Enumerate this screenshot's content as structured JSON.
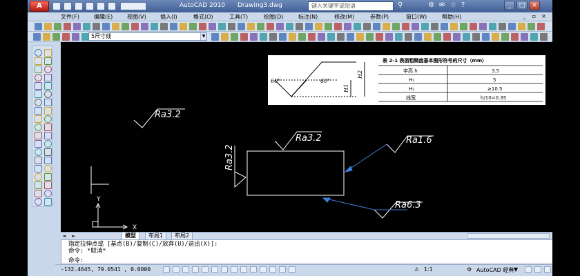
{
  "titlebar": {
    "logo": "A",
    "app_title": "AutoCAD 2010",
    "file_title": "Drawing3.dwg",
    "search_placeholder": "键入关键字或短语",
    "minimize": "_",
    "maximize": "□",
    "close": "×"
  },
  "menu": {
    "items": [
      "文件(F)",
      "编辑(E)",
      "视图(V)",
      "插入(I)",
      "格式(O)",
      "工具(T)",
      "绘图(D)",
      "标注(N)",
      "修改(M)",
      "参数(P)",
      "窗口(W)",
      "帮助(H)"
    ]
  },
  "layers": {
    "current_layer": "5尺寸线"
  },
  "drawing": {
    "roughness_labels": [
      "Ra3.2",
      "Ra3.2",
      "Ra1.6",
      "Ra3.2",
      "Ra6.3"
    ],
    "ucs_x": "X",
    "ucs_y": "Y"
  },
  "reference": {
    "title": "表 2-1  表面粗糙度基本图形符号的尺寸（mm）",
    "angle_left": "60°",
    "angle_right": "60°",
    "h1": "H1",
    "h2": "H2",
    "rows": [
      {
        "name": "字高 h",
        "value": "3.5"
      },
      {
        "name": "H₁",
        "value": "5"
      },
      {
        "name": "H₂",
        "value": "≥10.5"
      },
      {
        "name": "线宽",
        "value": "h/10=0.35"
      }
    ]
  },
  "tabs": {
    "items": [
      "模型",
      "布局1",
      "布局2"
    ]
  },
  "command": {
    "line1": "指定拉伸点或 [基点(B)/复制(C)/放弃(U)/退出(X)]:",
    "line2": "命令: *取消*",
    "prompt": "命令:"
  },
  "status": {
    "coords": "-132.4645, 79.0541 , 0.0000",
    "scale": "1:1",
    "workspace": "AutoCAD 经典"
  },
  "colors": {
    "canvas": "#000000",
    "leader": "#3f7fd6",
    "linework": "#ffffff",
    "title_bar": "#4f6fa5"
  }
}
